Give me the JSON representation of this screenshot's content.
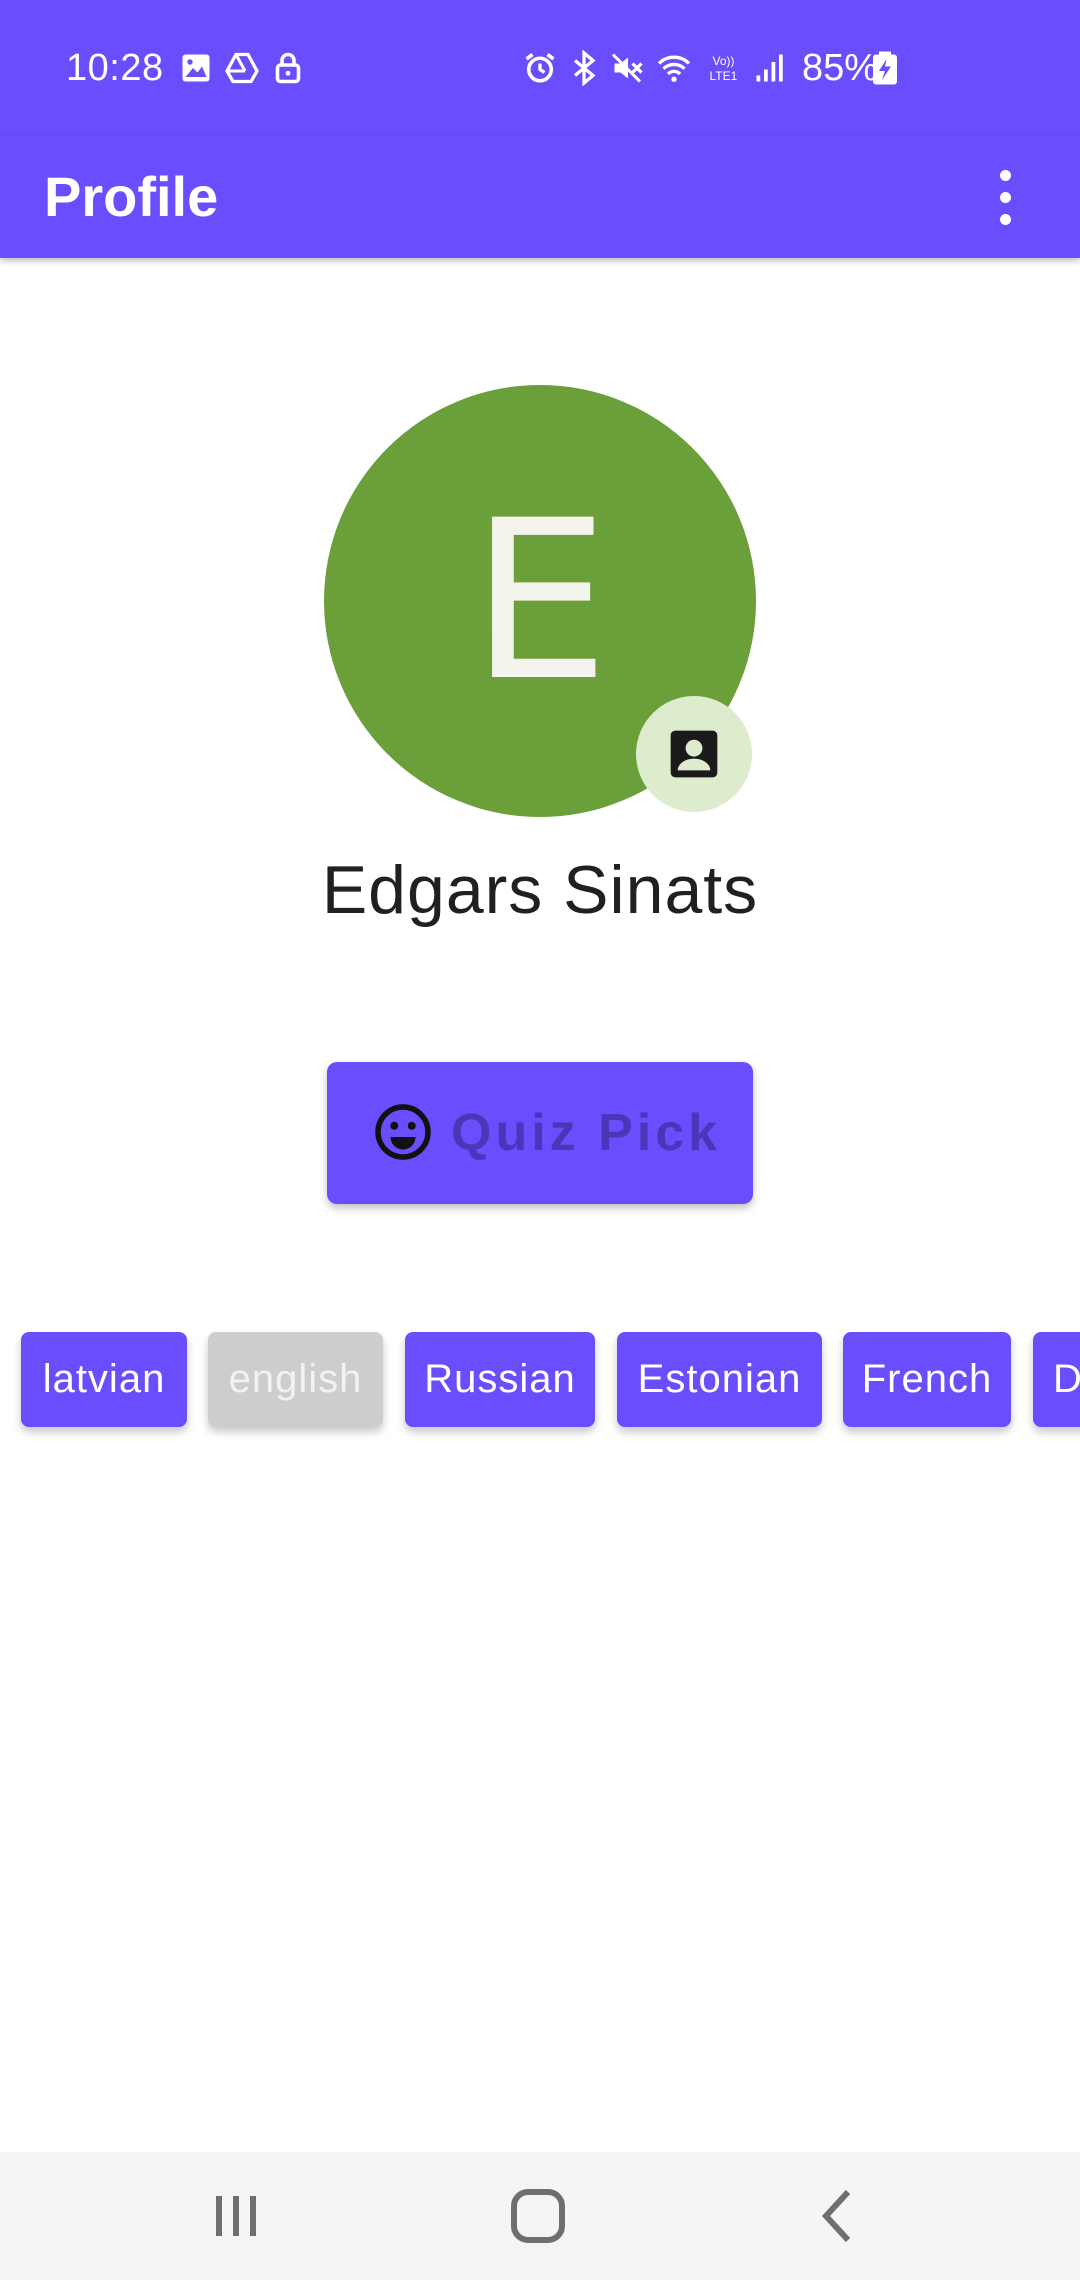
{
  "status_bar": {
    "time": "10:28",
    "battery": "85%",
    "left_icons": [
      "image-icon",
      "drive-icon",
      "lock-icon"
    ],
    "right_icons": [
      "alarm-icon",
      "bluetooth-icon",
      "mute-icon",
      "wifi-icon",
      "volte-icon",
      "signal-icon",
      "battery-icon"
    ]
  },
  "app_bar": {
    "title": "Profile",
    "menu_icon": "more-vert-icon"
  },
  "profile": {
    "avatar_initial": "E",
    "avatar_color": "#6a9f3a",
    "edit_icon": "contact-card-icon",
    "name": "Edgars Sinats"
  },
  "quiz": {
    "label": "Quiz Pick",
    "icon": "smiley-icon"
  },
  "languages": [
    {
      "label": "latvian",
      "enabled": true
    },
    {
      "label": "english",
      "enabled": false
    },
    {
      "label": "Russian",
      "enabled": true
    },
    {
      "label": "Estonian",
      "enabled": true
    },
    {
      "label": "French",
      "enabled": true
    },
    {
      "label": "D",
      "enabled": true
    }
  ],
  "nav_bar": {
    "icons": [
      "recents-icon",
      "home-icon",
      "back-icon"
    ]
  },
  "colors": {
    "primary": "#6a4dfc",
    "disabled_chip": "#cdcdcd",
    "nav_background": "#f5f5f5"
  }
}
